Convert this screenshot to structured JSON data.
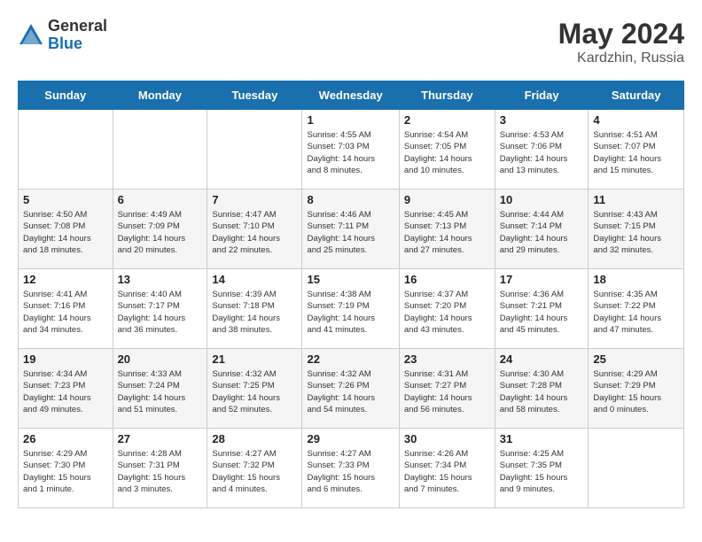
{
  "header": {
    "logo_general": "General",
    "logo_blue": "Blue",
    "month_year": "May 2024",
    "location": "Kardzhin, Russia"
  },
  "days_of_week": [
    "Sunday",
    "Monday",
    "Tuesday",
    "Wednesday",
    "Thursday",
    "Friday",
    "Saturday"
  ],
  "weeks": [
    [
      {
        "day": "",
        "info": ""
      },
      {
        "day": "",
        "info": ""
      },
      {
        "day": "",
        "info": ""
      },
      {
        "day": "1",
        "info": "Sunrise: 4:55 AM\nSunset: 7:03 PM\nDaylight: 14 hours\nand 8 minutes."
      },
      {
        "day": "2",
        "info": "Sunrise: 4:54 AM\nSunset: 7:05 PM\nDaylight: 14 hours\nand 10 minutes."
      },
      {
        "day": "3",
        "info": "Sunrise: 4:53 AM\nSunset: 7:06 PM\nDaylight: 14 hours\nand 13 minutes."
      },
      {
        "day": "4",
        "info": "Sunrise: 4:51 AM\nSunset: 7:07 PM\nDaylight: 14 hours\nand 15 minutes."
      }
    ],
    [
      {
        "day": "5",
        "info": "Sunrise: 4:50 AM\nSunset: 7:08 PM\nDaylight: 14 hours\nand 18 minutes."
      },
      {
        "day": "6",
        "info": "Sunrise: 4:49 AM\nSunset: 7:09 PM\nDaylight: 14 hours\nand 20 minutes."
      },
      {
        "day": "7",
        "info": "Sunrise: 4:47 AM\nSunset: 7:10 PM\nDaylight: 14 hours\nand 22 minutes."
      },
      {
        "day": "8",
        "info": "Sunrise: 4:46 AM\nSunset: 7:11 PM\nDaylight: 14 hours\nand 25 minutes."
      },
      {
        "day": "9",
        "info": "Sunrise: 4:45 AM\nSunset: 7:13 PM\nDaylight: 14 hours\nand 27 minutes."
      },
      {
        "day": "10",
        "info": "Sunrise: 4:44 AM\nSunset: 7:14 PM\nDaylight: 14 hours\nand 29 minutes."
      },
      {
        "day": "11",
        "info": "Sunrise: 4:43 AM\nSunset: 7:15 PM\nDaylight: 14 hours\nand 32 minutes."
      }
    ],
    [
      {
        "day": "12",
        "info": "Sunrise: 4:41 AM\nSunset: 7:16 PM\nDaylight: 14 hours\nand 34 minutes."
      },
      {
        "day": "13",
        "info": "Sunrise: 4:40 AM\nSunset: 7:17 PM\nDaylight: 14 hours\nand 36 minutes."
      },
      {
        "day": "14",
        "info": "Sunrise: 4:39 AM\nSunset: 7:18 PM\nDaylight: 14 hours\nand 38 minutes."
      },
      {
        "day": "15",
        "info": "Sunrise: 4:38 AM\nSunset: 7:19 PM\nDaylight: 14 hours\nand 41 minutes."
      },
      {
        "day": "16",
        "info": "Sunrise: 4:37 AM\nSunset: 7:20 PM\nDaylight: 14 hours\nand 43 minutes."
      },
      {
        "day": "17",
        "info": "Sunrise: 4:36 AM\nSunset: 7:21 PM\nDaylight: 14 hours\nand 45 minutes."
      },
      {
        "day": "18",
        "info": "Sunrise: 4:35 AM\nSunset: 7:22 PM\nDaylight: 14 hours\nand 47 minutes."
      }
    ],
    [
      {
        "day": "19",
        "info": "Sunrise: 4:34 AM\nSunset: 7:23 PM\nDaylight: 14 hours\nand 49 minutes."
      },
      {
        "day": "20",
        "info": "Sunrise: 4:33 AM\nSunset: 7:24 PM\nDaylight: 14 hours\nand 51 minutes."
      },
      {
        "day": "21",
        "info": "Sunrise: 4:32 AM\nSunset: 7:25 PM\nDaylight: 14 hours\nand 52 minutes."
      },
      {
        "day": "22",
        "info": "Sunrise: 4:32 AM\nSunset: 7:26 PM\nDaylight: 14 hours\nand 54 minutes."
      },
      {
        "day": "23",
        "info": "Sunrise: 4:31 AM\nSunset: 7:27 PM\nDaylight: 14 hours\nand 56 minutes."
      },
      {
        "day": "24",
        "info": "Sunrise: 4:30 AM\nSunset: 7:28 PM\nDaylight: 14 hours\nand 58 minutes."
      },
      {
        "day": "25",
        "info": "Sunrise: 4:29 AM\nSunset: 7:29 PM\nDaylight: 15 hours\nand 0 minutes."
      }
    ],
    [
      {
        "day": "26",
        "info": "Sunrise: 4:29 AM\nSunset: 7:30 PM\nDaylight: 15 hours\nand 1 minute."
      },
      {
        "day": "27",
        "info": "Sunrise: 4:28 AM\nSunset: 7:31 PM\nDaylight: 15 hours\nand 3 minutes."
      },
      {
        "day": "28",
        "info": "Sunrise: 4:27 AM\nSunset: 7:32 PM\nDaylight: 15 hours\nand 4 minutes."
      },
      {
        "day": "29",
        "info": "Sunrise: 4:27 AM\nSunset: 7:33 PM\nDaylight: 15 hours\nand 6 minutes."
      },
      {
        "day": "30",
        "info": "Sunrise: 4:26 AM\nSunset: 7:34 PM\nDaylight: 15 hours\nand 7 minutes."
      },
      {
        "day": "31",
        "info": "Sunrise: 4:25 AM\nSunset: 7:35 PM\nDaylight: 15 hours\nand 9 minutes."
      },
      {
        "day": "",
        "info": ""
      }
    ]
  ]
}
